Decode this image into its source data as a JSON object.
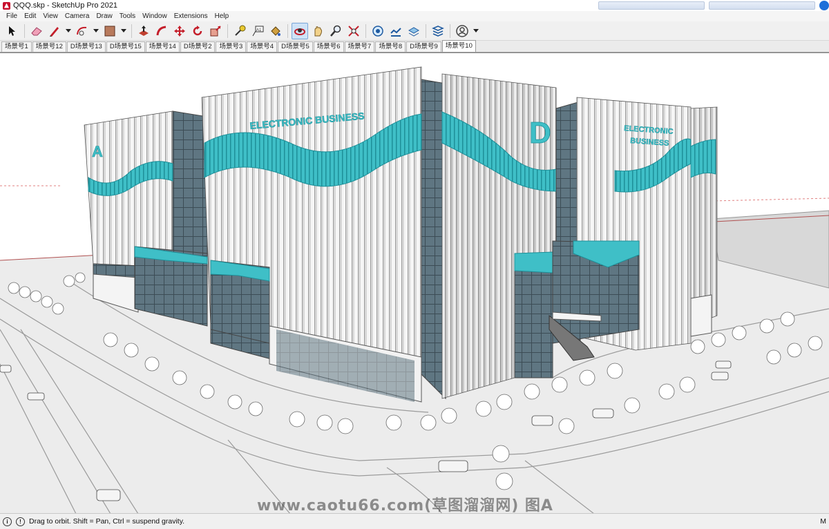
{
  "window": {
    "title": "QQQ.skp - SketchUp Pro 2021"
  },
  "menu": [
    "File",
    "Edit",
    "View",
    "Camera",
    "Draw",
    "Tools",
    "Window",
    "Extensions",
    "Help"
  ],
  "toolbar": {
    "tools": [
      "select-icon",
      "eraser-icon",
      "pencil-icon",
      "arc-icon",
      "rectangle-icon",
      "push-pull-icon",
      "follow-me-icon",
      "move-icon",
      "rotate-icon",
      "scale-icon",
      "tape-measure-icon",
      "text-icon",
      "paint-bucket-icon",
      "orbit-icon",
      "pan-icon",
      "zoom-icon",
      "zoom-extents-icon",
      "add-location-icon",
      "toggle-terrain-icon",
      "sandbox-icon",
      "send-to-layout-icon",
      "account-icon"
    ],
    "active_tool": "orbit-icon"
  },
  "scenes": {
    "tabs": [
      "场景号1",
      "场景号12",
      "D场景号13",
      "D场景号15",
      "场景号14",
      "D场景号2",
      "场景号3",
      "场景号4",
      "D场景号5",
      "场景号6",
      "场景号7",
      "场景号8",
      "D场景号9",
      "场景号10"
    ],
    "active": "场景号10"
  },
  "model": {
    "signage": {
      "building_a_letter": "A",
      "building_d_letter": "D",
      "facade_text_main": "ELECTRONIC BUSINESS",
      "facade_text_right_line1": "ELECTRONIC",
      "facade_text_right_line2": "BUSINESS"
    },
    "colors": {
      "accent_teal": "#3fbfc7",
      "glass": "#5f7682",
      "fin_white": "#e8e8e8",
      "ground": "#ececec"
    }
  },
  "watermark": "www.caotu66.com(草图溜溜网) 图A",
  "status": {
    "hint": "Drag to orbit. Shift = Pan, Ctrl = suspend gravity.",
    "measurements_label": "M"
  }
}
